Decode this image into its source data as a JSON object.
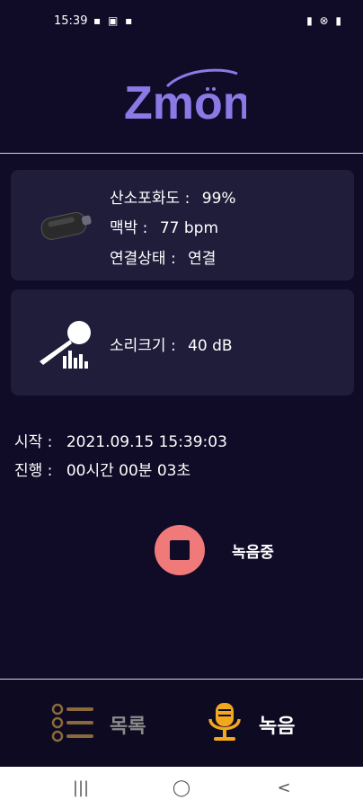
{
  "status_bar": {
    "time": "15:39",
    "left_icons": "▪ ▣ ▪",
    "right_icons": "▮ ⊗ ▮"
  },
  "logo": {
    "text": "Zmon",
    "color": "#8b7ae6"
  },
  "sensor_card": {
    "spo2_label": "산소포화도 :",
    "spo2_value": "99%",
    "pulse_label": "맥박 :",
    "pulse_value": "77 bpm",
    "connection_label": "연결상태 :",
    "connection_value": "연결"
  },
  "sound_card": {
    "volume_label": "소리크기 :",
    "volume_value": "40 dB"
  },
  "session": {
    "start_label": "시작 :",
    "start_value": "2021.09.15 15:39:03",
    "elapsed_label": "진행 :",
    "elapsed_value": "00시간 00분 03초"
  },
  "recording": {
    "status_label": "녹음중",
    "button_color": "#f07a7a"
  },
  "bottom_nav": {
    "list_label": "목록",
    "record_label": "녹음",
    "list_icon_color": "#8a6a3a",
    "record_icon_color": "#f2a81d"
  },
  "system_nav": {
    "recents": "|||",
    "home": "◯",
    "back": "<"
  }
}
